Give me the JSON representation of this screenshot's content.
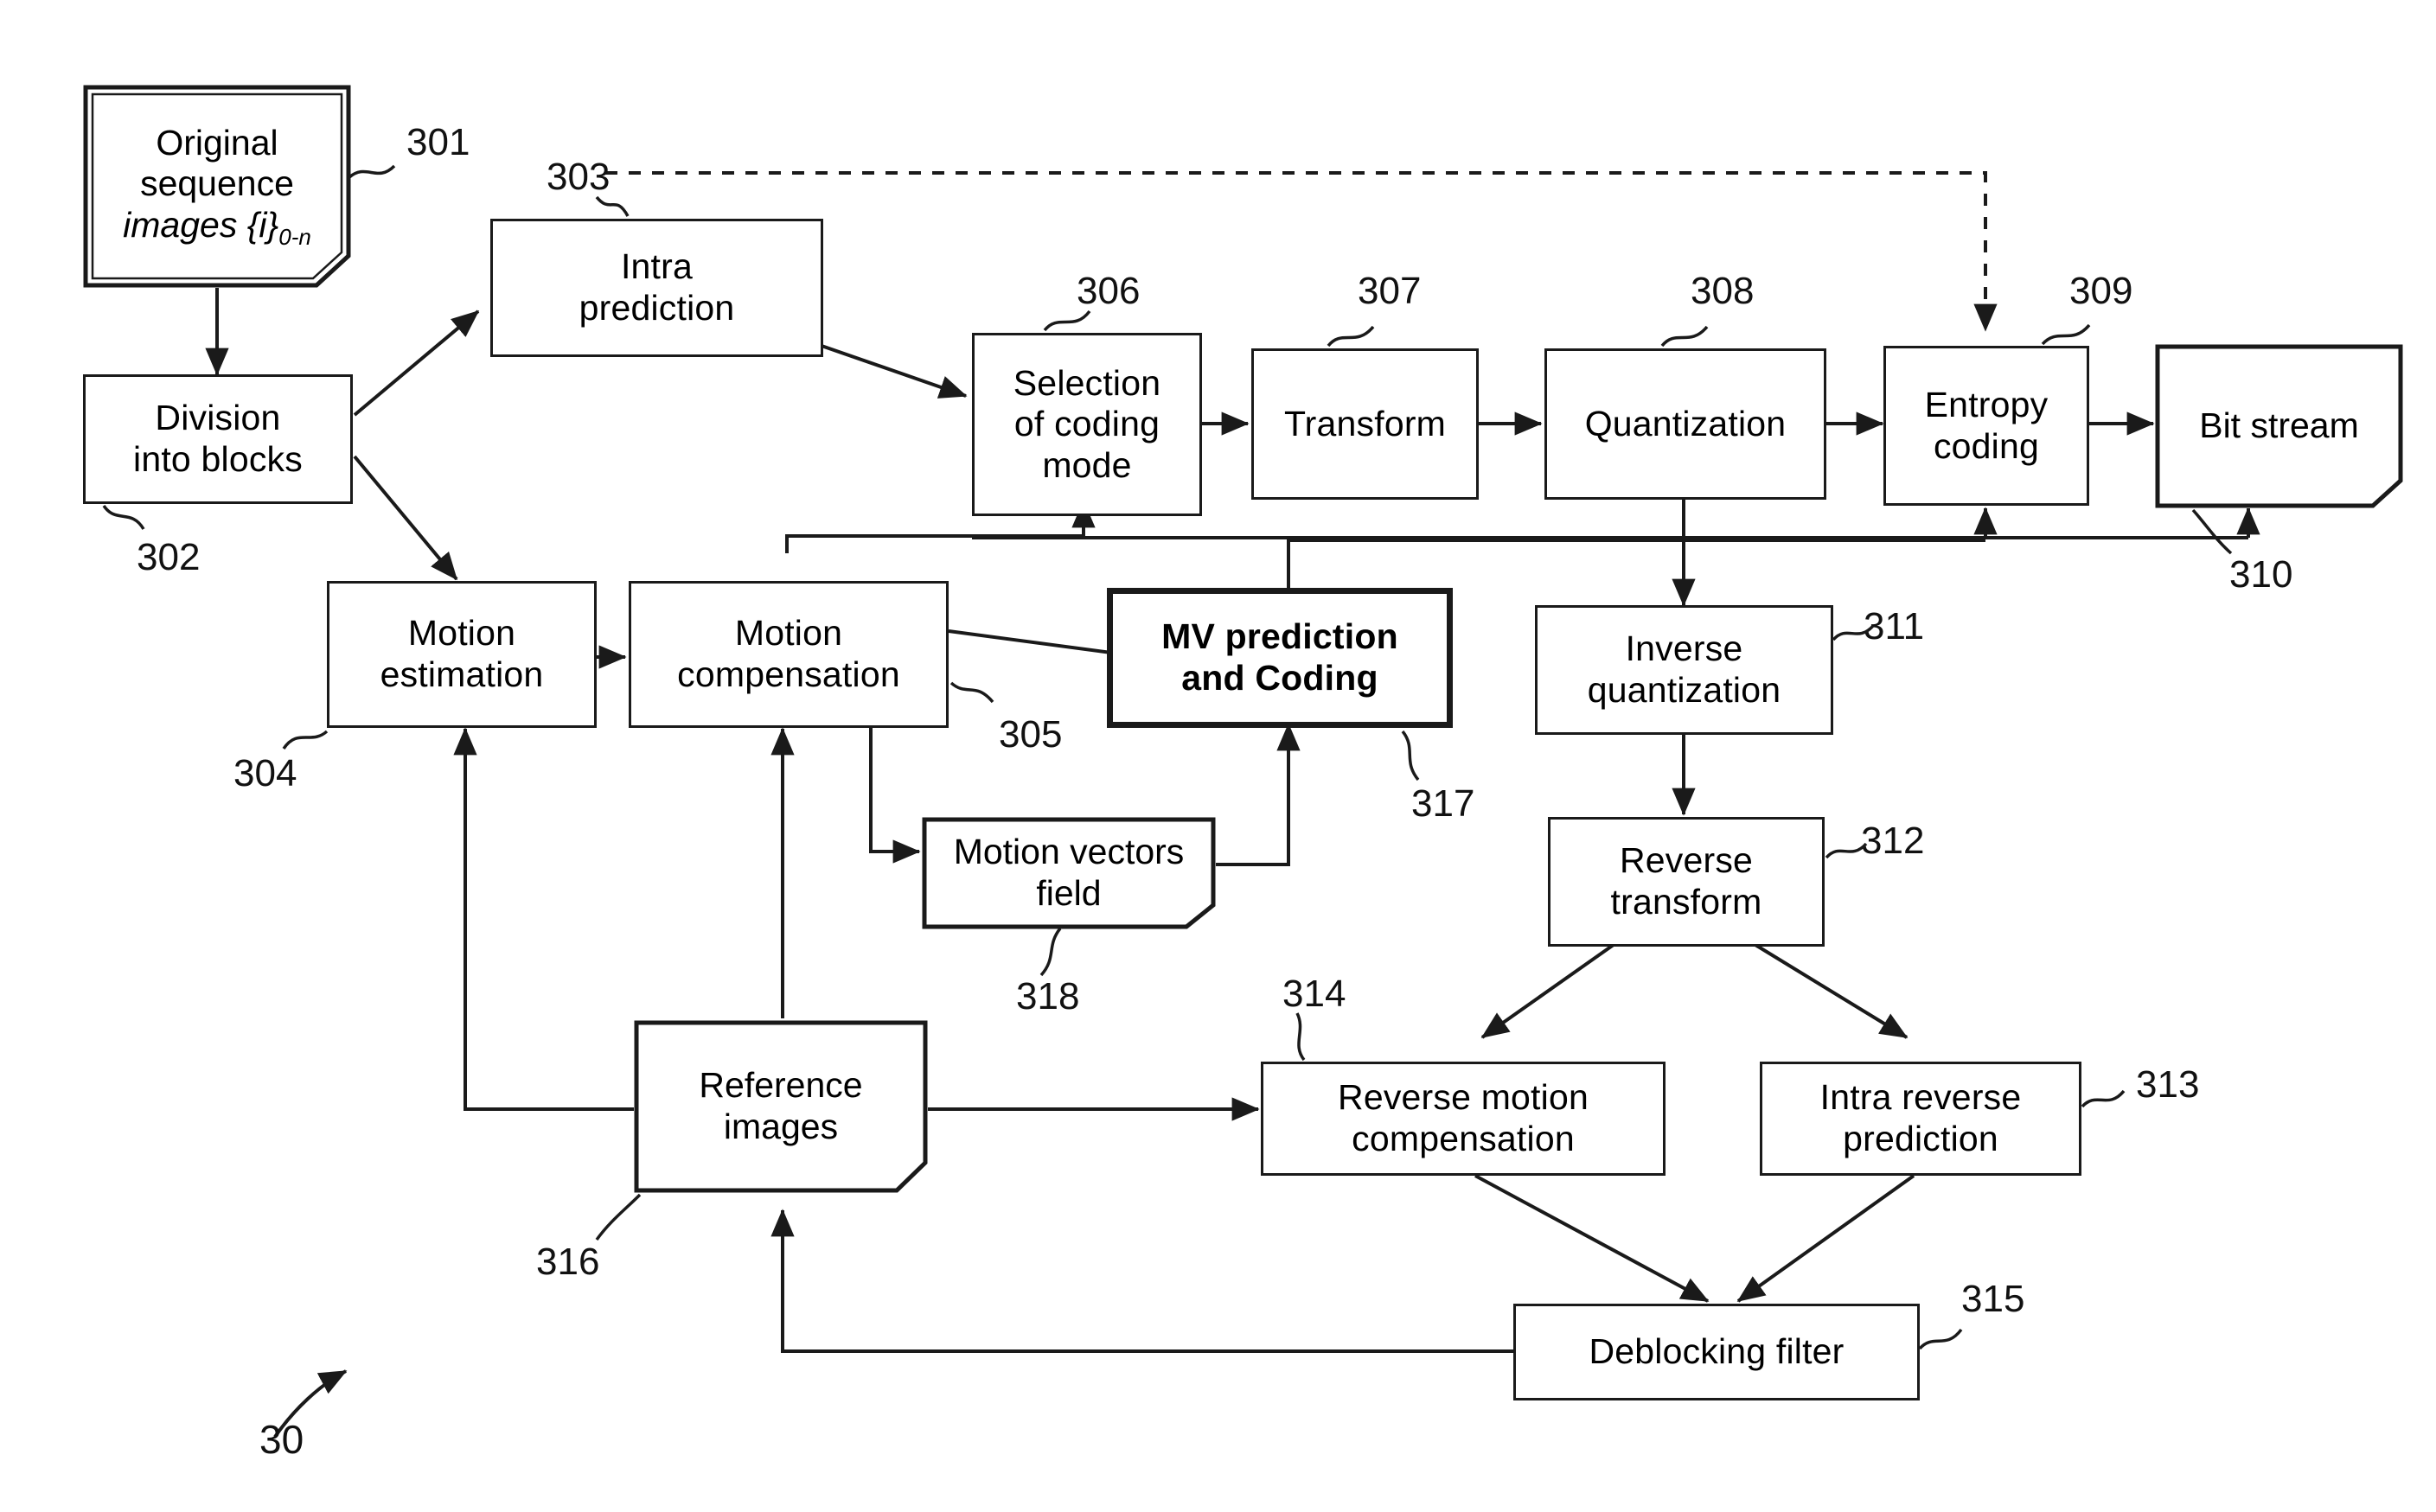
{
  "figure": {
    "id": "30",
    "type": "video-encoder-block-diagram"
  },
  "blocks": [
    {
      "key": "original_sequence",
      "lines": [
        "Original",
        "sequence"
      ],
      "italic_line": "images {i}",
      "subscript": "0-n",
      "ref": "301"
    },
    {
      "key": "division_into_blocks",
      "label": "Division\ninto blocks",
      "ref": "302"
    },
    {
      "key": "intra_prediction",
      "label": "Intra\nprediction",
      "ref": "303"
    },
    {
      "key": "selection_of_coding_mode",
      "label": "Selection\nof coding\nmode",
      "ref": "306"
    },
    {
      "key": "transform",
      "label": "Transform",
      "ref": "307"
    },
    {
      "key": "quantization",
      "label": "Quantization",
      "ref": "308"
    },
    {
      "key": "entropy_coding",
      "label": "Entropy\ncoding",
      "ref": "309"
    },
    {
      "key": "bit_stream",
      "label": "Bit stream",
      "ref": "310"
    },
    {
      "key": "motion_estimation",
      "label": "Motion\nestimation",
      "ref": "304"
    },
    {
      "key": "motion_compensation",
      "label": "Motion\ncompensation",
      "ref": "305"
    },
    {
      "key": "mv_prediction_and_coding",
      "label": "MV prediction\nand Coding",
      "ref": "317"
    },
    {
      "key": "inverse_quantization",
      "label": "Inverse\nquantization",
      "ref": "311"
    },
    {
      "key": "reverse_transform",
      "label": "Reverse\ntransform",
      "ref": "312"
    },
    {
      "key": "motion_vectors_field",
      "label": "Motion vectors\nfield",
      "ref": "318"
    },
    {
      "key": "reference_images",
      "label": "Reference\nimages",
      "ref": "316"
    },
    {
      "key": "reverse_motion_compensation",
      "label": "Reverse motion\ncompensation",
      "ref": "314"
    },
    {
      "key": "intra_reverse_prediction",
      "label": "Intra reverse\nprediction",
      "ref": "313"
    },
    {
      "key": "deblocking_filter",
      "label": "Deblocking filter",
      "ref": "315"
    }
  ],
  "labels": {
    "original_sequence_l1": "Original",
    "original_sequence_l2": "sequence",
    "original_sequence_l3_italic": "images {i}",
    "original_sequence_l3_sub": "0-n",
    "division_into_blocks": "Division\ninto blocks",
    "intra_prediction": "Intra\nprediction",
    "selection_of_coding_mode": "Selection\nof coding\nmode",
    "transform": "Transform",
    "quantization": "Quantization",
    "entropy_coding": "Entropy\ncoding",
    "bit_stream": "Bit stream",
    "motion_estimation": "Motion\nestimation",
    "motion_compensation": "Motion\ncompensation",
    "mv_prediction_and_coding": "MV prediction\nand Coding",
    "inverse_quantization": "Inverse\nquantization",
    "reverse_transform": "Reverse\ntransform",
    "motion_vectors_field": "Motion vectors\nfield",
    "reference_images": "Reference\nimages",
    "reverse_motion_compensation": "Reverse motion\ncompensation",
    "intra_reverse_prediction": "Intra reverse\nprediction",
    "deblocking_filter": "Deblocking filter"
  },
  "refnums": {
    "n301": "301",
    "n302": "302",
    "n303": "303",
    "n304": "304",
    "n305": "305",
    "n306": "306",
    "n307": "307",
    "n308": "308",
    "n309": "309",
    "n310": "310",
    "n311": "311",
    "n312": "312",
    "n313": "313",
    "n314": "314",
    "n315": "315",
    "n316": "316",
    "n317": "317",
    "n318": "318",
    "n30": "30"
  },
  "colors": {
    "stroke": "#1a1a1a",
    "background": "#ffffff",
    "text": "#000000"
  },
  "connections": [
    {
      "from": "original_sequence",
      "to": "division_into_blocks",
      "style": "solid"
    },
    {
      "from": "division_into_blocks",
      "to": "intra_prediction",
      "style": "solid"
    },
    {
      "from": "division_into_blocks",
      "to": "motion_estimation",
      "style": "solid"
    },
    {
      "from": "intra_prediction",
      "to": "selection_of_coding_mode",
      "style": "solid"
    },
    {
      "from": "motion_compensation",
      "to": "selection_of_coding_mode",
      "style": "solid"
    },
    {
      "from": "selection_of_coding_mode",
      "to": "transform",
      "style": "solid"
    },
    {
      "from": "transform",
      "to": "quantization",
      "style": "solid"
    },
    {
      "from": "quantization",
      "to": "entropy_coding",
      "style": "solid"
    },
    {
      "from": "entropy_coding",
      "to": "bit_stream",
      "style": "solid"
    },
    {
      "from": "intra_prediction",
      "to": "entropy_coding",
      "style": "dashed"
    },
    {
      "from": "motion_estimation",
      "to": "motion_compensation",
      "style": "solid"
    },
    {
      "from": "motion_compensation",
      "to": "mv_prediction_and_coding",
      "style": "solid"
    },
    {
      "from": "motion_compensation",
      "to": "motion_vectors_field",
      "style": "solid"
    },
    {
      "from": "motion_vectors_field",
      "to": "mv_prediction_and_coding",
      "style": "solid"
    },
    {
      "from": "mv_prediction_and_coding",
      "to": "entropy_coding",
      "style": "solid"
    },
    {
      "from": "mv_prediction_and_coding",
      "to": "bit_stream",
      "style": "solid"
    },
    {
      "from": "quantization",
      "to": "inverse_quantization",
      "style": "solid"
    },
    {
      "from": "inverse_quantization",
      "to": "reverse_transform",
      "style": "solid"
    },
    {
      "from": "reverse_transform",
      "to": "reverse_motion_compensation",
      "style": "solid"
    },
    {
      "from": "reverse_transform",
      "to": "intra_reverse_prediction",
      "style": "solid"
    },
    {
      "from": "reference_images",
      "to": "reverse_motion_compensation",
      "style": "solid"
    },
    {
      "from": "reference_images",
      "to": "motion_estimation",
      "style": "solid"
    },
    {
      "from": "reference_images",
      "to": "motion_compensation",
      "style": "solid"
    },
    {
      "from": "reverse_motion_compensation",
      "to": "deblocking_filter",
      "style": "solid"
    },
    {
      "from": "intra_reverse_prediction",
      "to": "deblocking_filter",
      "style": "solid"
    },
    {
      "from": "deblocking_filter",
      "to": "reference_images",
      "style": "solid"
    }
  ]
}
